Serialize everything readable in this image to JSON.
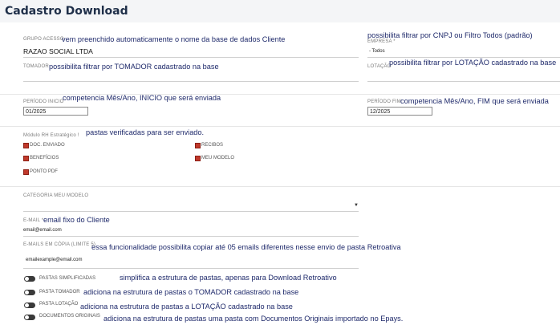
{
  "page": {
    "title": "Cadastro Download"
  },
  "grupo_acesso": {
    "label": "GRUPO ACESSO",
    "note": "vem preenchido automaticamente o nome da base de dados Cliente",
    "value": "RAZAO SOCIAL LTDA"
  },
  "empresa": {
    "note": "possibilita filtrar por CNPJ ou Filtro Todos (padrão)",
    "label": "EMPRESA *",
    "value": "- Todos"
  },
  "tomador": {
    "label": "TOMADOR",
    "note": "possibilita filtrar por TOMADOR cadastrado na base"
  },
  "lotacao": {
    "label": "LOTAÇÃO",
    "note": "possibilita filtrar por LOTAÇÃO cadastrado na base"
  },
  "periodo_inicio": {
    "label": "PERÍODO INICIO",
    "note": "competencia Mês/Ano, INICIO que será enviada",
    "value": "01/2025"
  },
  "periodo_fim": {
    "label": "PERÍODO FIM",
    "note": "competencia Mês/Ano, FIM que será enviada",
    "value": "12/2025"
  },
  "modulo": {
    "label": "Módulo RH Estratégico !",
    "note": "pastas verificadas para ser enviado.",
    "options": [
      {
        "label": "DOC. ENVIADO",
        "checked": true
      },
      {
        "label": "RECIBOS",
        "checked": true
      },
      {
        "label": "BENEFÍCIOS",
        "checked": true
      },
      {
        "label": "MEU MODELO",
        "checked": true
      },
      {
        "label": "PONTO PDF",
        "checked": true
      }
    ]
  },
  "categoria": {
    "label": "CATEGORIA MEU MODELO"
  },
  "email": {
    "label": "E-MAIL *",
    "note": "email fixo do Cliente",
    "value": "email@email.com"
  },
  "emails_copia": {
    "label": "E-MAILS EM CÓPIA (LIMITE 5)",
    "note": "essa funcionalidade possibilita copiar até 05 emails diferentes nesse envio de pasta Retroativa",
    "value": "emailexample@email.com"
  },
  "toggles": [
    {
      "label": "PASTAS SIMPLIFICADAS",
      "note": "simplifica a estrutura de pastas, apenas para Download Retroativo"
    },
    {
      "label": "PASTA TOMADOR",
      "note": "adiciona na estrutura de pastas o TOMADOR cadastrado na base"
    },
    {
      "label": "PASTA LOTAÇÃO",
      "note": "adiciona na estrutura de pastas a LOTAÇÃO cadastrado na base"
    },
    {
      "label": "DOCUMENTOS ORIGINAIS",
      "note": "adiciona na estrutura de pastas uma pasta com Documentos Originais importado no Epays."
    }
  ],
  "colors": {
    "title": "#1f2f49",
    "note": "#1f2a6b",
    "checkbox": "#c0392b",
    "toggle": "#3a3a3a"
  }
}
